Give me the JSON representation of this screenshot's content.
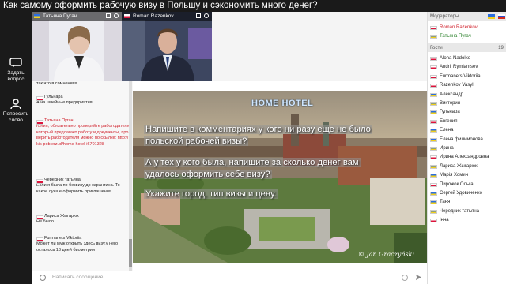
{
  "window": {
    "title": "Как самому оформить рабочую визу в Польшу и сэкономить много денег?"
  },
  "rail": {
    "ask_label": "Задать вопрос",
    "speak_label": "Попросить слово"
  },
  "video_tiles": [
    {
      "name": "Татьяна Пугач"
    },
    {
      "name": "Roman Razenkov"
    }
  ],
  "chat": {
    "messages": [
      {
        "author": "",
        "text": "так что в сомнениях."
      },
      {
        "author": "Гульнара",
        "text": "А на швейные предприятия"
      },
      {
        "author": "Татьяна Пугач",
        "moderator": true,
        "text": "Юлия, обязательно проверяйте работодателя который предлагает работу и документы, проверить работодателя можно по ссылке: http://kis-pobierz.pl/home-hotel-i6701328"
      },
      {
        "author": "Чередник татьяна",
        "text": "Если я была по безвизу до карантина. То какое лучше оформить приглашения"
      },
      {
        "author": "Лариса Жыгарюк",
        "text": "Не было"
      },
      {
        "author": "Furmanets Viktoriia",
        "text": "Может ли муж открыть здесь визу,у него осталось 13 дней биометрии"
      }
    ],
    "input_placeholder": "Написать сообщение"
  },
  "slide": {
    "logo": "HOME HOTEL",
    "lines": [
      "Напишите в комментариях у кого ни разу еще не было",
      "польской рабочей визы?",
      "А у тех у кого была, напишите за сколько денег вам",
      "удалось оформить себе визу?",
      "Укажите город, тип визы и цену."
    ],
    "watermark": "© Jan Graczyński"
  },
  "panel": {
    "moderators_title": "Модераторы",
    "moderators": [
      {
        "name": "Roman Razenkov",
        "flag": "pl"
      },
      {
        "name": "Татьяна Пугач",
        "flag": "ua"
      }
    ],
    "guests_title": "Гости",
    "guests_count": "19",
    "guests": [
      {
        "name": "Alona Nadolko",
        "flag": "pl"
      },
      {
        "name": "Andrii Rymiantsev",
        "flag": "pl"
      },
      {
        "name": "Furmanets Viktoriia",
        "flag": "pl"
      },
      {
        "name": "Razenkov Vasyl",
        "flag": "pl"
      },
      {
        "name": "Александр",
        "flag": "ua"
      },
      {
        "name": "Виктория",
        "flag": "ua"
      },
      {
        "name": "Гульнара",
        "flag": "ua"
      },
      {
        "name": "Евгения",
        "flag": "pl"
      },
      {
        "name": "Елена",
        "flag": "ua"
      },
      {
        "name": "Елена филимонова",
        "flag": "ua"
      },
      {
        "name": "Ирина",
        "flag": "ua"
      },
      {
        "name": "Ирина Александровна",
        "flag": "pl"
      },
      {
        "name": "Лариса Жыгарюк",
        "flag": "ua"
      },
      {
        "name": "Марія Хомин",
        "flag": "ua"
      },
      {
        "name": "Пирожок Ольга",
        "flag": "pl"
      },
      {
        "name": "Сергей Удовиченко",
        "flag": "ua"
      },
      {
        "name": "Таня",
        "flag": "ua"
      },
      {
        "name": "Чередник татьяна",
        "flag": "ua"
      },
      {
        "name": "Інна",
        "flag": "pl"
      }
    ]
  },
  "colors": {
    "moderator_red": "#d0202b",
    "titlebar": "#1a1a1a"
  }
}
